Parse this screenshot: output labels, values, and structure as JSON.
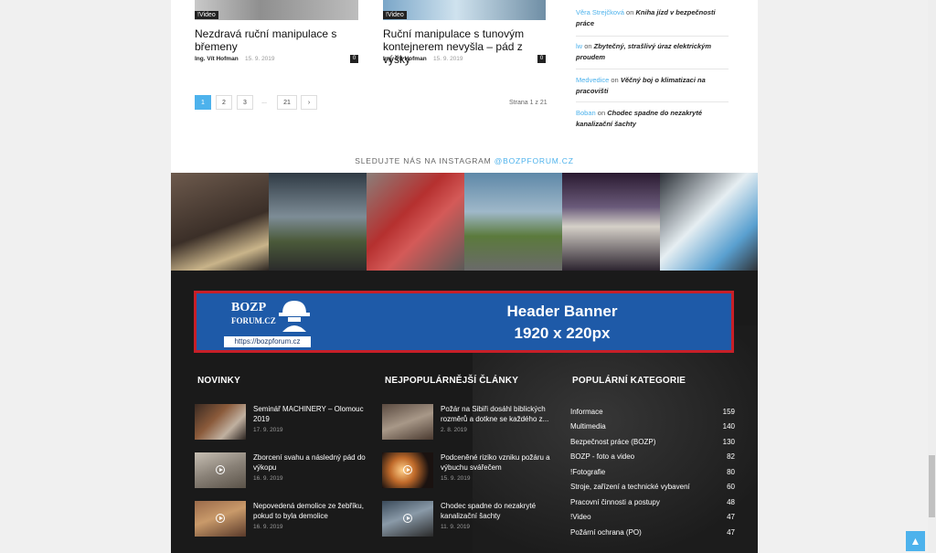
{
  "articles": [
    {
      "tag": "!Video",
      "title": "Nezdravá ruční manipulace s břemeny",
      "author": "Ing. Vít Hofman",
      "date": "15. 9. 2019",
      "comments": "0"
    },
    {
      "tag": "!Video",
      "title": "Ruční manipulace s tunovým kontejnerem nevyšla – pád z výšky",
      "author": "Ing. Vít Hofman",
      "date": "15. 9. 2019",
      "comments": "0"
    }
  ],
  "pagination": {
    "pages": [
      "1",
      "2",
      "3",
      "...",
      "21"
    ],
    "next": "›",
    "status": "Strana 1 z 21"
  },
  "comments": [
    {
      "who": "Věra Strejčková",
      "on": "on",
      "what": "Kniha jízd v bezpečnosti práce"
    },
    {
      "who": "lw",
      "on": "on",
      "what": "Zbytečný, strašlivý úraz elektrickým proudem"
    },
    {
      "who": "Medvedice",
      "on": "on",
      "what": "Věčný boj o klimatizaci na pracovišti"
    },
    {
      "who": "Boban",
      "on": "on",
      "what": "Chodec spadne do nezakryté kanalizační šachty"
    }
  ],
  "instagram": {
    "label": "SLEDUJTE NÁS NA INSTAGRAM",
    "handle": "@BOZPFORUM.CZ"
  },
  "banner": {
    "logo_top": "BOZP",
    "logo_bottom": "FORUM.CZ",
    "url": "https://bozpforum.cz",
    "line1": "Header Banner",
    "line2": "1920 x 220px"
  },
  "footer": {
    "novinky": {
      "heading": "NOVINKY",
      "items": [
        {
          "title": "Seminář MACHINERY – Olomouc 2019",
          "date": "17. 9. 2019"
        },
        {
          "title": "Zborcení svahu a následný pád do výkopu",
          "date": "16. 9. 2019"
        },
        {
          "title": "Nepovedená demolice ze žebříku, pokud to byla demolice",
          "date": "16. 9. 2019"
        }
      ]
    },
    "popular": {
      "heading": "NEJPOPULÁRNĚJŠÍ ČLÁNKY",
      "items": [
        {
          "title": "Požár na Sibiři dosáhl biblických rozměrů a dotkne se každého z...",
          "date": "2. 8. 2019"
        },
        {
          "title": "Podceněné riziko vzniku požáru a výbuchu svářečem",
          "date": "15. 9. 2019"
        },
        {
          "title": "Chodec spadne do nezakryté kanalizační šachty",
          "date": "11. 9. 2019"
        }
      ]
    },
    "categories": {
      "heading": "POPULÁRNÍ KATEGORIE",
      "items": [
        {
          "name": "Informace",
          "count": "159"
        },
        {
          "name": "Multimedia",
          "count": "140"
        },
        {
          "name": "Bezpečnost práce (BOZP)",
          "count": "130"
        },
        {
          "name": "BOZP - foto a video",
          "count": "82"
        },
        {
          "name": "!Fotografie",
          "count": "80"
        },
        {
          "name": "Stroje, zařízení a technické vybavení",
          "count": "60"
        },
        {
          "name": "Pracovní činnosti a postupy",
          "count": "48"
        },
        {
          "name": "!Video",
          "count": "47"
        },
        {
          "name": "Požární ochrana (PO)",
          "count": "47"
        }
      ]
    }
  },
  "scroll_top_icon": "arrow-up-icon",
  "colors": {
    "accent": "#4db2ec",
    "footer_bg": "#1a1a1a",
    "banner_blue": "#1e5aa8",
    "banner_border": "#c71f28"
  }
}
